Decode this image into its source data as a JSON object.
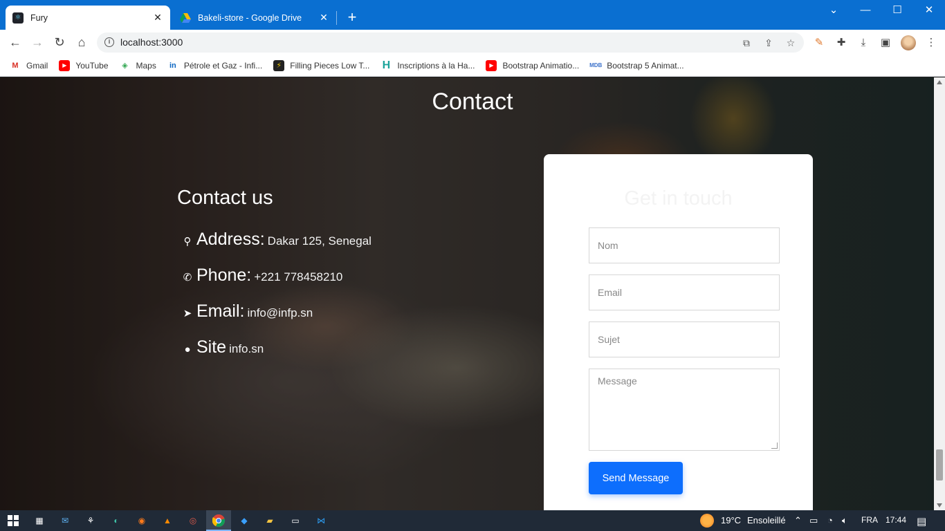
{
  "browser": {
    "tabs": [
      {
        "title": "Fury",
        "active": true,
        "icon": "react-icon"
      },
      {
        "title": "Bakeli-store - Google Drive",
        "active": false,
        "icon": "google-drive-icon"
      }
    ],
    "url": "localhost:3000",
    "bookmarks": [
      {
        "label": "Gmail",
        "icon": "gmail-icon",
        "color": "#d93025"
      },
      {
        "label": "YouTube",
        "icon": "youtube-icon",
        "color": "#ff0000"
      },
      {
        "label": "Maps",
        "icon": "maps-icon",
        "color": "#34a853"
      },
      {
        "label": "Pétrole et Gaz - Infi...",
        "icon": "linkedin-icon",
        "color": "#0a66c2"
      },
      {
        "label": "Filling Pieces Low T...",
        "icon": "filling-pieces-icon",
        "color": "#222222"
      },
      {
        "label": "Inscriptions à la Ha...",
        "icon": "h-icon",
        "color": "#1aa39a"
      },
      {
        "label": "Bootstrap Animatio...",
        "icon": "youtube-icon",
        "color": "#ff0000"
      },
      {
        "label": "Bootstrap 5 Animat...",
        "icon": "mdb-icon",
        "color": "#3b71ca"
      }
    ]
  },
  "page": {
    "section_title": "Contact",
    "contact_heading": "Contact us",
    "info": [
      {
        "icon": "map-pin-icon",
        "label": "Address:",
        "value": "Dakar 125, Senegal"
      },
      {
        "icon": "phone-icon",
        "label": "Phone:",
        "value": "+221 778458210"
      },
      {
        "icon": "send-icon",
        "label": "Email:",
        "value": "info@infp.sn"
      },
      {
        "icon": "globe-icon",
        "label": "Site",
        "value": "info.sn"
      }
    ],
    "form": {
      "title": "Get in touch",
      "name_placeholder": "Nom",
      "email_placeholder": "Email",
      "subject_placeholder": "Sujet",
      "message_placeholder": "Message",
      "submit_label": "Send Message",
      "accent": "#0d6efd"
    }
  },
  "taskbar": {
    "temperature": "19°C",
    "weather": "Ensoleillé",
    "language": "FRA",
    "time": "17:44"
  }
}
